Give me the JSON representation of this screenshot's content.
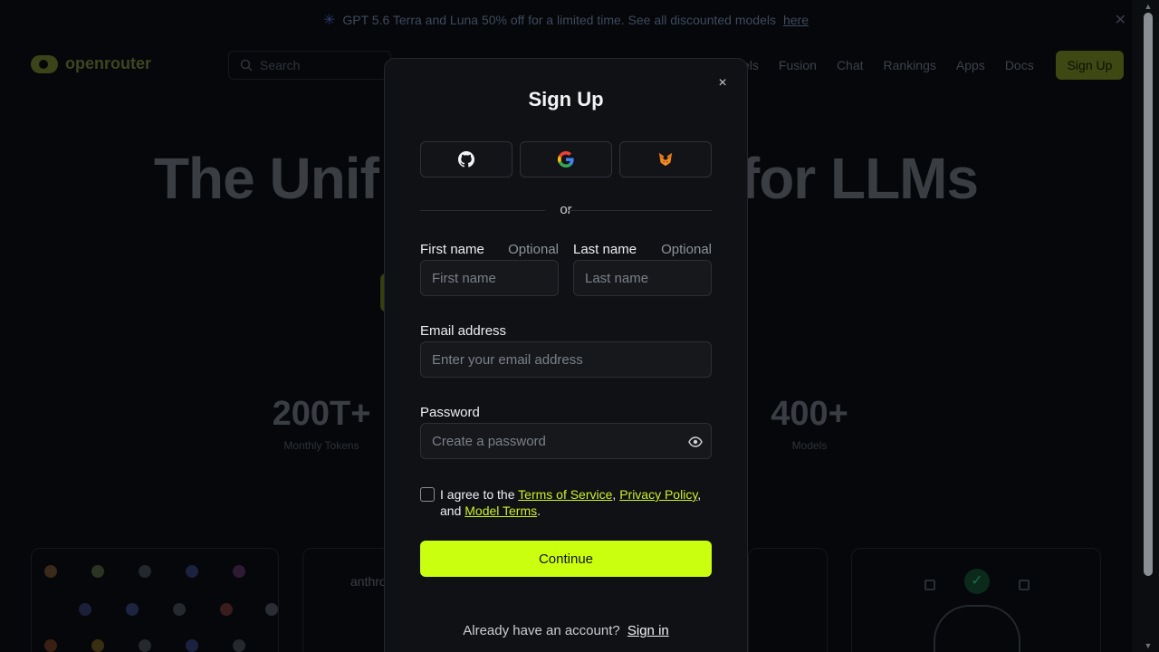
{
  "banner": {
    "text": "GPT 5.6 Terra and Luna 50% off for a limited time. See all discounted models",
    "link": "here"
  },
  "nav": {
    "logo": "openrouter",
    "search_placeholder": "Search",
    "links": [
      "els",
      "Fusion",
      "Chat",
      "Rankings",
      "Apps",
      "Docs"
    ],
    "signup": "Sign Up"
  },
  "hero": {
    "title_left": "The Unif",
    "title_right": "for LLMs"
  },
  "stats": [
    {
      "value": "200T+",
      "label": "Monthly Tokens"
    },
    {
      "value": "400+",
      "label": "Models"
    }
  ],
  "cards": {
    "anthropic_fragment": "anthro"
  },
  "modal": {
    "title": "Sign Up",
    "close": "×",
    "divider": "or",
    "first_name": {
      "label": "First name",
      "optional": "Optional",
      "placeholder": "First name"
    },
    "last_name": {
      "label": "Last name",
      "optional": "Optional",
      "placeholder": "Last name"
    },
    "email": {
      "label": "Email address",
      "placeholder": "Enter your email address"
    },
    "password": {
      "label": "Password",
      "placeholder": "Create a password"
    },
    "agree": {
      "prefix": "I agree to the",
      "tos": "Terms of Service",
      "privacy": "Privacy Policy",
      "and": "and",
      "model_terms": "Model Terms"
    },
    "continue": "Continue",
    "signin_prompt": "Already have an account?",
    "signin_link": "Sign in"
  },
  "colors": {
    "accent": "#cbff10",
    "modal_bg": "#0f1114",
    "link_accent": "#cdf12a"
  },
  "icons": [
    "github-icon",
    "google-icon",
    "metamask-icon",
    "eye-icon",
    "close-icon",
    "search-icon"
  ]
}
